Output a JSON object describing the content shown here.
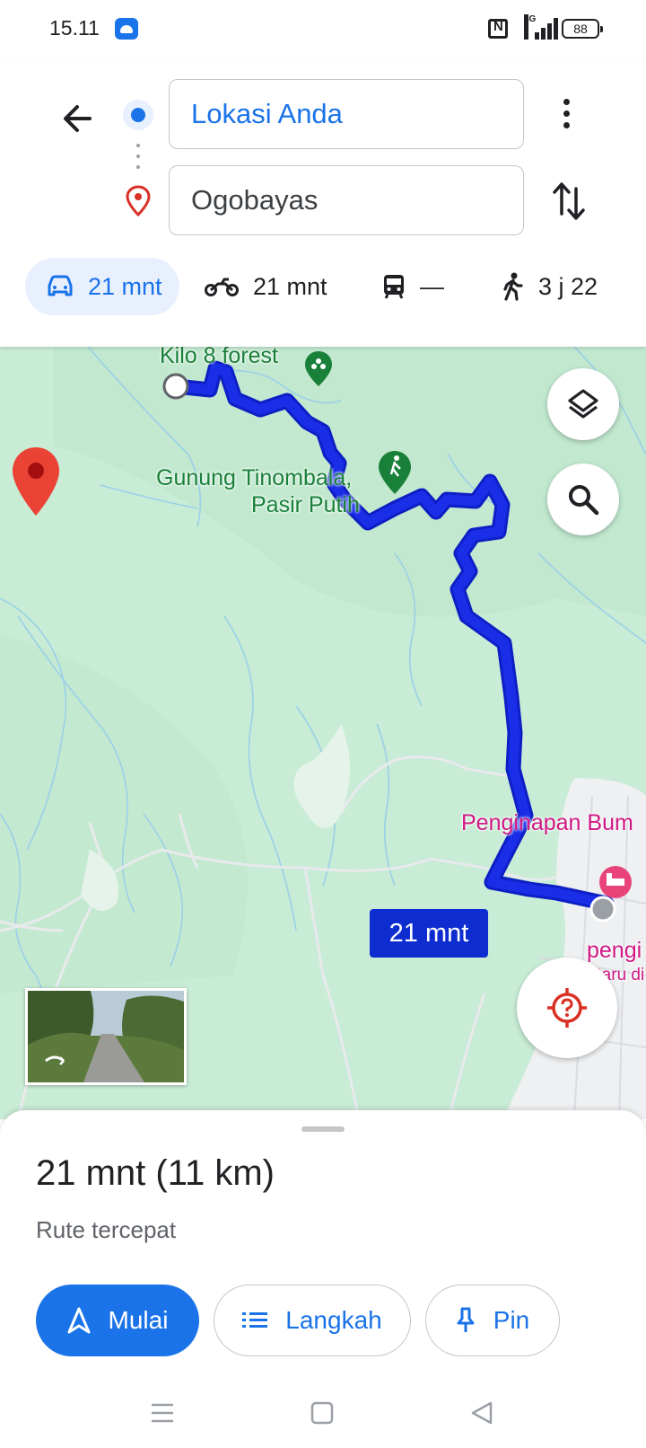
{
  "status": {
    "time": "15.11",
    "network": "4G",
    "battery": "88"
  },
  "directions": {
    "origin": "Lokasi Anda",
    "destination": "Ogobayas"
  },
  "modes": [
    {
      "name": "car",
      "label": "21 mnt",
      "active": true
    },
    {
      "name": "motorcycle",
      "label": "21 mnt",
      "active": false
    },
    {
      "name": "transit",
      "label": "—",
      "active": false
    },
    {
      "name": "walk",
      "label": "3 j 22",
      "active": false
    }
  ],
  "map": {
    "labels": {
      "forest": "Kilo 8 forest",
      "mountain_line1": "Gunung Tinombala,",
      "mountain_line2": "Pasir Putih",
      "lodging": "Penginapan Bum",
      "lodging2_line1": "pengi",
      "lodging2_line2": "Baru di"
    },
    "eta_badge": "21 mnt",
    "route_color": "#1a2ee8"
  },
  "sheet": {
    "summary": "21 mnt (11 km)",
    "subtitle": "Rute tercepat",
    "start_label": "Mulai",
    "steps_label": "Langkah",
    "pin_label": "Pin"
  },
  "colors": {
    "accent": "#1a73e8",
    "route": "#1a2ee8",
    "map_green": "#c8ecd5"
  }
}
